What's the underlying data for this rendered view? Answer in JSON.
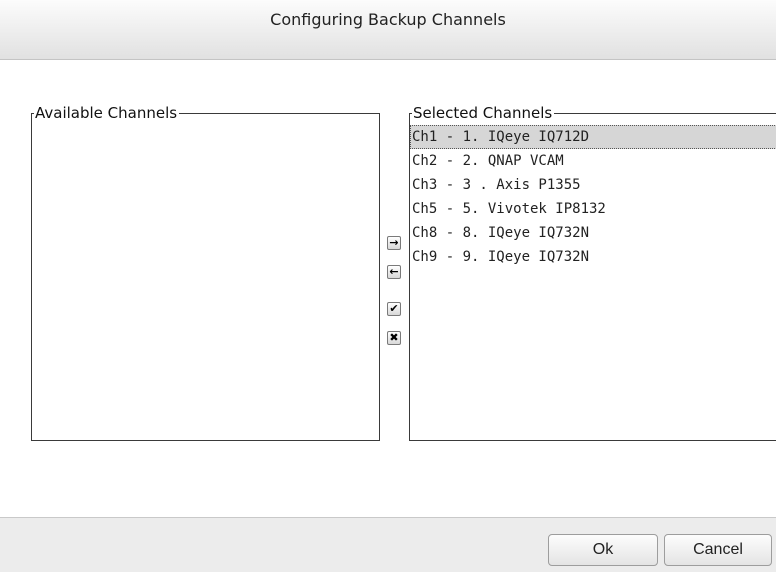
{
  "dialog": {
    "title": "Configuring Backup Channels"
  },
  "available": {
    "legend": "Available Channels",
    "items": []
  },
  "selected": {
    "legend": "Selected Channels",
    "items": [
      "Ch1 - 1. IQeye IQ712D",
      "Ch2 - 2. QNAP VCAM",
      "Ch3 - 3 . Axis P1355",
      "Ch5 - 5. Vivotek IP8132",
      "Ch8 - 8. IQeye IQ732N",
      "Ch9 - 9. IQeye IQ732N"
    ],
    "highlighted_index": 0
  },
  "transfer_buttons": {
    "add": "→",
    "remove": "←",
    "add_all": "✔",
    "remove_all": "✖"
  },
  "footer": {
    "ok_label": "Ok",
    "cancel_label": "Cancel"
  }
}
